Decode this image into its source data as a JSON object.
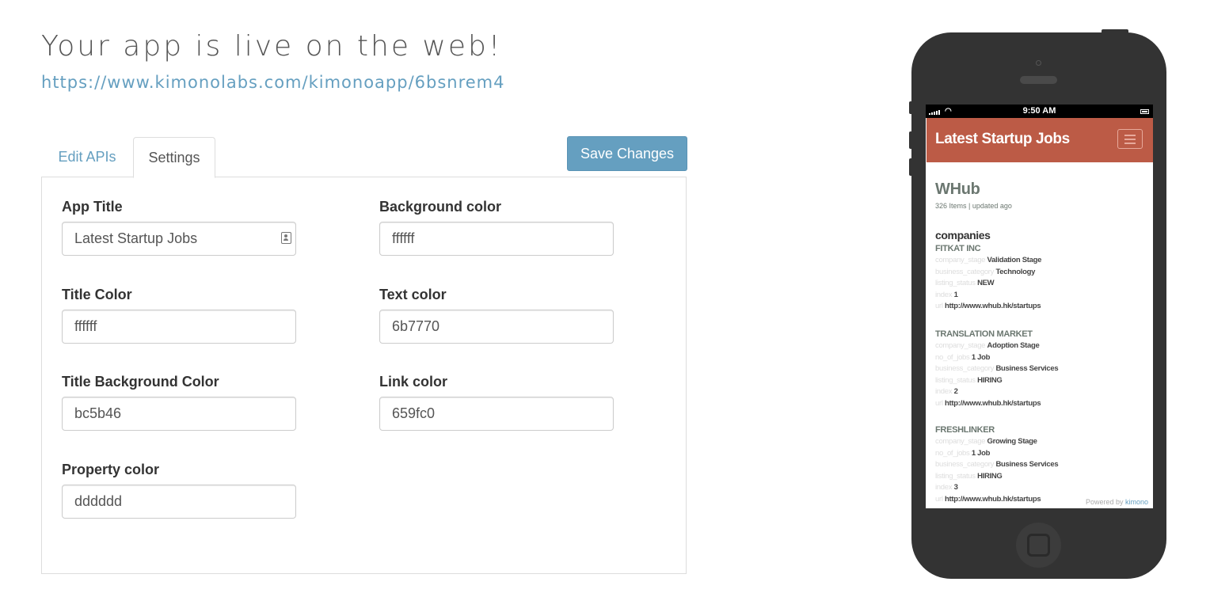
{
  "page": {
    "heading": "Your app is live on the web!",
    "url": "https://www.kimonolabs.com/kimonoapp/6bsnrem4"
  },
  "tabs": [
    {
      "label": "Edit APIs",
      "active": false
    },
    {
      "label": "Settings",
      "active": true
    }
  ],
  "save_label": "Save Changes",
  "settings": {
    "app_title": {
      "label": "App Title",
      "value": "Latest Startup Jobs"
    },
    "background_color": {
      "label": "Background color",
      "value": "ffffff"
    },
    "title_color": {
      "label": "Title Color",
      "value": "ffffff"
    },
    "text_color": {
      "label": "Text color",
      "value": "6b7770"
    },
    "title_background_color": {
      "label": "Title Background Color",
      "value": "bc5b46"
    },
    "link_color": {
      "label": "Link color",
      "value": "659fc0"
    },
    "property_color": {
      "label": "Property color",
      "value": "dddddd"
    }
  },
  "preview": {
    "status_time": "9:50 AM",
    "app_title": "Latest Startup Jobs",
    "api_title": "WHub",
    "api_meta": "326 Items | updated ago",
    "collection": "companies",
    "companies": [
      {
        "name": "FITKAT INC",
        "props": [
          {
            "key": "company_stage",
            "value": "Validation Stage"
          },
          {
            "key": "business_category",
            "value": "Technology"
          },
          {
            "key": "listing_status",
            "value": "NEW"
          },
          {
            "key": "index",
            "value": "1"
          },
          {
            "key": "url",
            "value": "http://www.whub.hk/startups"
          }
        ]
      },
      {
        "name": "TRANSLATION MARKET",
        "props": [
          {
            "key": "company_stage",
            "value": "Adoption Stage"
          },
          {
            "key": "no_of_jobs",
            "value": "1 Job"
          },
          {
            "key": "business_category",
            "value": "Business Services"
          },
          {
            "key": "listing_status",
            "value": "HIRING"
          },
          {
            "key": "index",
            "value": "2"
          },
          {
            "key": "url",
            "value": "http://www.whub.hk/startups"
          }
        ]
      },
      {
        "name": "FRESHLINKER",
        "props": [
          {
            "key": "company_stage",
            "value": "Growing Stage"
          },
          {
            "key": "no_of_jobs",
            "value": "1 Job"
          },
          {
            "key": "business_category",
            "value": "Business Services"
          },
          {
            "key": "listing_status",
            "value": "HIRING"
          },
          {
            "key": "index",
            "value": "3"
          },
          {
            "key": "url",
            "value": "http://www.whub.hk/startups"
          }
        ]
      }
    ],
    "powered_by": "Powered by",
    "powered_link": "kimono"
  },
  "colors": {
    "accent": "#659fc0",
    "title_background": "#bc5b46",
    "text": "#6b7770",
    "property": "#dddddd",
    "phone_body": "#333333"
  },
  "icons": [
    "contact-card-icon",
    "signal-icon",
    "wifi-icon",
    "battery-icon",
    "hamburger-menu-icon",
    "home-button-icon"
  ]
}
